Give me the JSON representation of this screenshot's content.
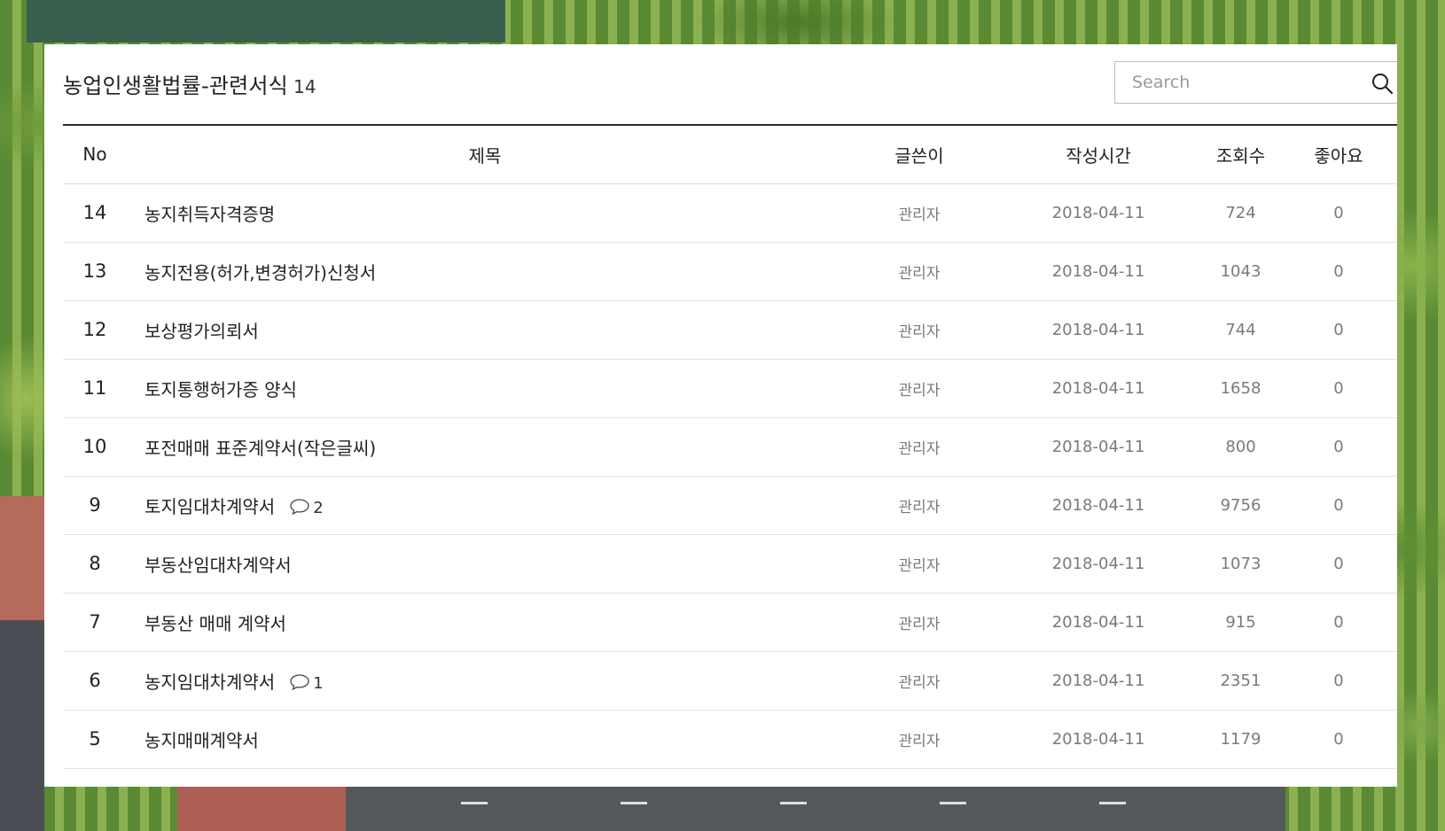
{
  "board": {
    "title": "농업인생활법률-관련서식",
    "count": "14"
  },
  "search": {
    "placeholder": "Search",
    "value": "",
    "icon": "search-icon"
  },
  "table": {
    "headers": {
      "no": "No",
      "subject": "제목",
      "author": "글쓴이",
      "date": "작성시간",
      "views": "조회수",
      "likes": "좋아요"
    },
    "rows": [
      {
        "no": "14",
        "subject": "농지취득자격증명",
        "comments": "",
        "author": "관리자",
        "date": "2018-04-11",
        "views": "724",
        "likes": "0"
      },
      {
        "no": "13",
        "subject": "농지전용(허가,변경허가)신청서",
        "comments": "",
        "author": "관리자",
        "date": "2018-04-11",
        "views": "1043",
        "likes": "0"
      },
      {
        "no": "12",
        "subject": "보상평가의뢰서",
        "comments": "",
        "author": "관리자",
        "date": "2018-04-11",
        "views": "744",
        "likes": "0"
      },
      {
        "no": "11",
        "subject": "토지통행허가증 양식",
        "comments": "",
        "author": "관리자",
        "date": "2018-04-11",
        "views": "1658",
        "likes": "0"
      },
      {
        "no": "10",
        "subject": "포전매매 표준계약서(작은글씨)",
        "comments": "",
        "author": "관리자",
        "date": "2018-04-11",
        "views": "800",
        "likes": "0"
      },
      {
        "no": "9",
        "subject": "토지임대차계약서",
        "comments": "2",
        "author": "관리자",
        "date": "2018-04-11",
        "views": "9756",
        "likes": "0"
      },
      {
        "no": "8",
        "subject": "부동산임대차계약서",
        "comments": "",
        "author": "관리자",
        "date": "2018-04-11",
        "views": "1073",
        "likes": "0"
      },
      {
        "no": "7",
        "subject": "부동산 매매 계약서",
        "comments": "",
        "author": "관리자",
        "date": "2018-04-11",
        "views": "915",
        "likes": "0"
      },
      {
        "no": "6",
        "subject": "농지임대차계약서",
        "comments": "1",
        "author": "관리자",
        "date": "2018-04-11",
        "views": "2351",
        "likes": "0"
      },
      {
        "no": "5",
        "subject": "농지매매계약서",
        "comments": "",
        "author": "관리자",
        "date": "2018-04-11",
        "views": "1179",
        "likes": "0"
      }
    ]
  }
}
